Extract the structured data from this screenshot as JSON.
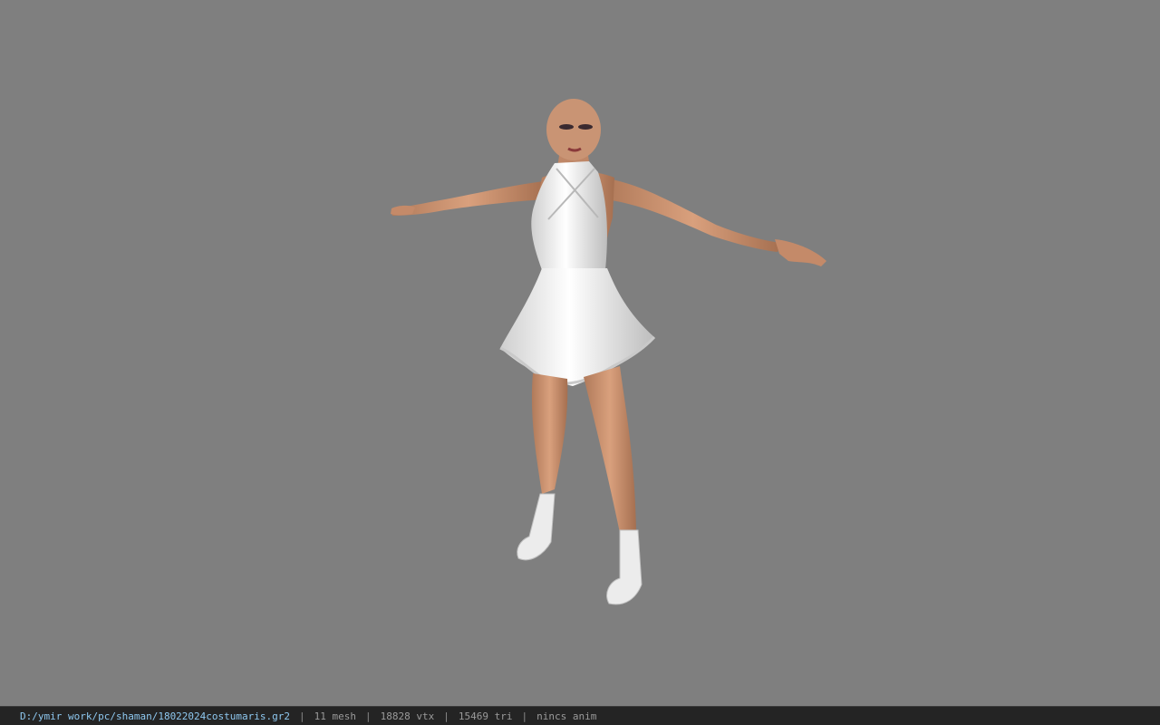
{
  "viewport": {
    "background": "#7f7f7f"
  },
  "statusbar": {
    "file_path": "D:/ymir work/pc/shaman/18022024costumaris.gr2",
    "separator": "|",
    "mesh_count": "11 mesh",
    "vertex_count": "18828 vtx",
    "triangle_count": "15469 tri",
    "anim_status": "nincs anim"
  },
  "colors": {
    "skin": "#c98f6e",
    "dress": "#eeeeee",
    "path_text": "#8ec8f0",
    "status_bg": "#242424"
  }
}
